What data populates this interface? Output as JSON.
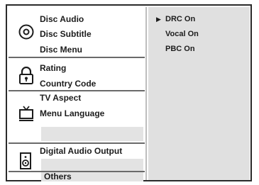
{
  "menu": {
    "groups": [
      {
        "icon": "disc-icon",
        "items": [
          "Disc Audio",
          "Disc Subtitle",
          "Disc Menu"
        ]
      },
      {
        "icon": "lock-icon",
        "items": [
          "Rating",
          "Country Code"
        ]
      },
      {
        "icon": "tv-icon",
        "items": [
          "TV Aspect",
          "Menu Language"
        ]
      },
      {
        "icon": "speaker-icon",
        "items": [
          "Digital Audio Output"
        ]
      }
    ],
    "others_label": "Others"
  },
  "options": {
    "cursor": "▶",
    "items": [
      "DRC On",
      "Vocal On",
      "PBC On"
    ]
  }
}
